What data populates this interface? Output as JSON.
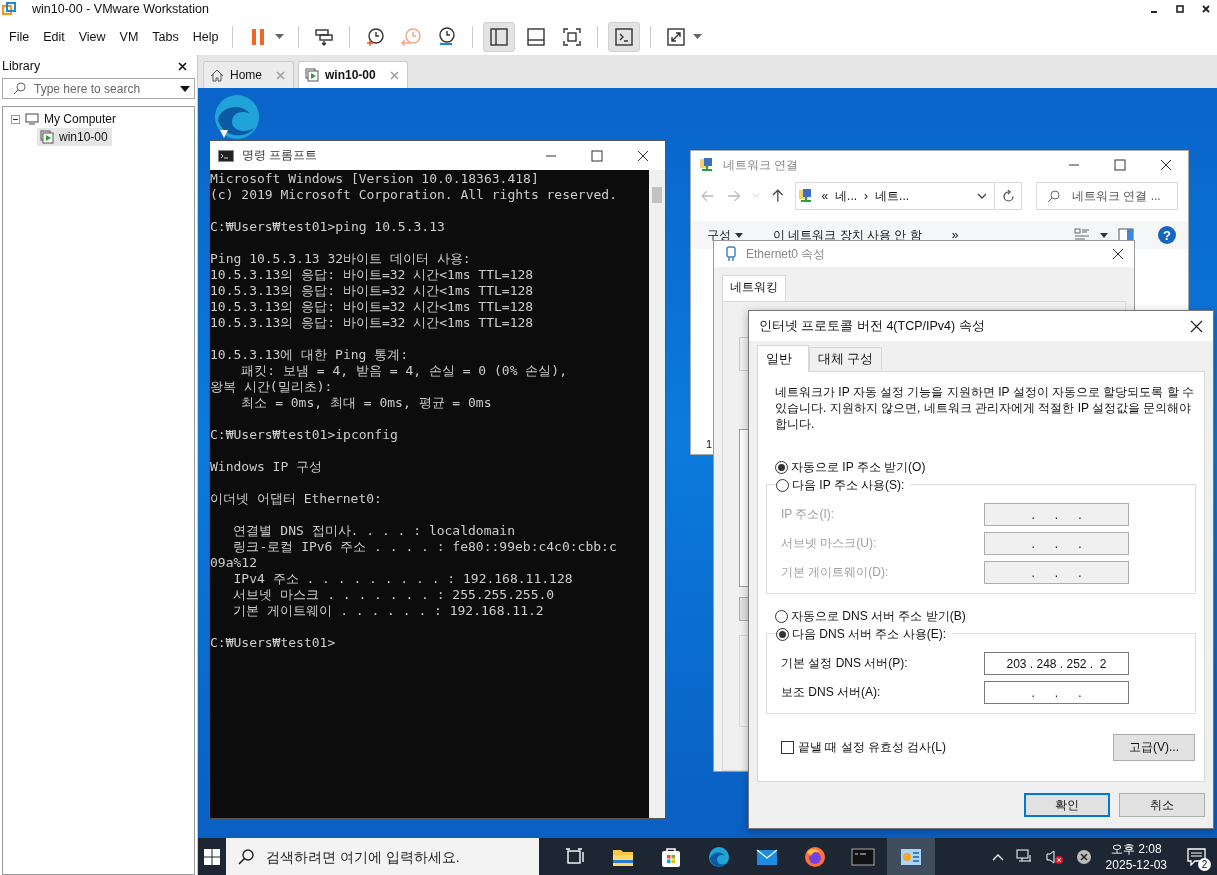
{
  "app": {
    "title": "win10-00 - VMware Workstation"
  },
  "menu": [
    {
      "label": "File"
    },
    {
      "label": "Edit"
    },
    {
      "label": "View"
    },
    {
      "label": "VM"
    },
    {
      "label": "Tabs"
    },
    {
      "label": "Help"
    }
  ],
  "toolbar": [
    [
      {
        "kind": "pause",
        "dropdown": true,
        "selected": false
      }
    ],
    [
      {
        "kind": "send-keys",
        "dropdown": false,
        "selected": false
      }
    ],
    [
      {
        "kind": "snapshot-take",
        "dropdown": false,
        "selected": false
      },
      {
        "kind": "snapshot-revert",
        "dropdown": false,
        "selected": false
      },
      {
        "kind": "snapshot-manager",
        "dropdown": false,
        "selected": false
      }
    ],
    [
      {
        "kind": "view-library",
        "dropdown": false,
        "selected": true
      },
      {
        "kind": "view-thumbnails",
        "dropdown": false,
        "selected": false
      },
      {
        "kind": "view-full",
        "dropdown": false,
        "selected": false
      }
    ],
    [
      {
        "kind": "console",
        "dropdown": false,
        "selected": true
      }
    ],
    [
      {
        "kind": "stretch",
        "dropdown": true,
        "selected": false
      }
    ]
  ],
  "library": {
    "title": "Library",
    "search": {
      "placeholder": "Type here to search"
    },
    "tree": [
      {
        "label": "My Computer",
        "expanded": true,
        "selected": false,
        "children": [
          {
            "label": "win10-00",
            "selected": true
          }
        ]
      }
    ]
  },
  "tabs": [
    {
      "label": "Home",
      "kind": "home",
      "selected": false
    },
    {
      "label": "win10-00",
      "kind": "vm",
      "selected": true
    }
  ],
  "desktop_icons": [
    {
      "kind": "edge"
    }
  ],
  "cmd": {
    "title": "명령 프롬프트",
    "blocks": [
      {
        "lines": [
          "Microsoft Windows [Version 10.0.18363.418]",
          "(c) 2019 Microsoft Corporation. All rights reserved."
        ]
      },
      {
        "lines": [
          "C:₩Users₩test01>ping 10.5.3.13"
        ]
      },
      {
        "lines": [
          "Ping 10.5.3.13 32바이트 데이터 사용:",
          "10.5.3.13의 응답: 바이트=32 시간<1ms TTL=128",
          "10.5.3.13의 응답: 바이트=32 시간<1ms TTL=128",
          "10.5.3.13의 응답: 바이트=32 시간<1ms TTL=128",
          "10.5.3.13의 응답: 바이트=32 시간<1ms TTL=128"
        ]
      },
      {
        "lines": [
          "10.5.3.13에 대한 Ping 통계:",
          "    패킷: 보냄 = 4, 받음 = 4, 손실 = 0 (0% 손실),",
          "왕복 시간(밀리초):",
          "    최소 = 0ms, 최대 = 0ms, 평균 = 0ms"
        ]
      },
      {
        "lines": [
          "C:₩Users₩test01>ipconfig"
        ]
      },
      {
        "lines": [
          "Windows IP 구성"
        ]
      },
      {
        "lines": [
          "이더넷 어댑터 Ethernet0:"
        ]
      },
      {
        "lines": [
          "   연결별 DNS 접미사. . . . : localdomain",
          "   링크-로컬 IPv6 주소 . . . . : fe80::99eb:c4c0:cbb:c",
          "09a%12",
          "   IPv4 주소 . . . . . . . . . : 192.168.11.128",
          "   서브넷 마스크 . . . . . . . : 255.255.255.0",
          "   기본 게이트웨이 . . . . . . : 192.168.11.2"
        ]
      },
      {
        "lines": [
          "C:₩Users₩test01>"
        ]
      }
    ]
  },
  "network_connections": {
    "title": "네트워크 연결",
    "breadcrumb": [
      "«",
      "네...",
      "›",
      "네트..."
    ],
    "search": {
      "placeholder": "네트워크 연결 ..."
    },
    "commands": [
      {
        "label": "구성",
        "dropdown": true
      },
      {
        "label": "이 네트워크 장치 사용 안 함",
        "dropdown": false
      },
      {
        "label": "»",
        "dropdown": false
      }
    ],
    "help": "?",
    "status": "1"
  },
  "ethernet_properties": {
    "title": "Ethernet0 속성",
    "tabs": [
      {
        "label": "네트워킹",
        "selected": true
      }
    ]
  },
  "ipv4_properties": {
    "title": "인터넷 프로토콜 버전 4(TCP/IPv4) 속성",
    "tabs": [
      {
        "label": "일반",
        "selected": true
      },
      {
        "label": "대체 구성",
        "selected": false
      }
    ],
    "description": "네트워크가 IP 자동 설정 기능을 지원하면 IP 설정이 자동으로 할당되도록 할 수 있습니다. 지원하지 않으면, 네트워크 관리자에게 적절한 IP 설정값을 문의해야 합니다.",
    "ip_options": [
      {
        "label": "자동으로 IP 주소 받기(O)",
        "selected": true
      },
      {
        "label": "다음 IP 주소 사용(S):",
        "selected": false
      }
    ],
    "ip_fields": [
      {
        "label": "IP 주소(I):",
        "value": ".      .      .",
        "disabled": true
      },
      {
        "label": "서브넷 마스크(U):",
        "value": ".      .      .",
        "disabled": true
      },
      {
        "label": "기본 게이트웨이(D):",
        "value": ".      .      .",
        "disabled": true
      }
    ],
    "dns_options": [
      {
        "label": "자동으로 DNS 서버 주소 받기(B)",
        "selected": false
      },
      {
        "label": "다음 DNS 서버 주소 사용(E):",
        "selected": true
      }
    ],
    "dns_fields": [
      {
        "label": "기본 설정 DNS 서버(P):",
        "value": "203 . 248 . 252 .  2",
        "disabled": false
      },
      {
        "label": "보조 DNS 서버(A):",
        "value": ".      .      .",
        "disabled": false
      }
    ],
    "validate": {
      "label": "끝낼 때 설정 유효성 검사(L)",
      "checked": false
    },
    "advanced": "고급(V)...",
    "buttons": [
      {
        "label": "확인",
        "default": true
      },
      {
        "label": "취소",
        "default": false
      }
    ]
  },
  "taskbar": {
    "search": {
      "placeholder": "검색하려면 여기에 입력하세요."
    },
    "apps": [
      {
        "kind": "task-view",
        "active": false
      },
      {
        "kind": "folder",
        "active": false
      },
      {
        "kind": "store",
        "active": false
      },
      {
        "kind": "edge",
        "active": false
      },
      {
        "kind": "mail",
        "active": false
      },
      {
        "kind": "firefox",
        "active": false
      },
      {
        "kind": "terminal",
        "active": false
      },
      {
        "kind": "control-panel",
        "active": true
      }
    ],
    "time": "오후 2:08",
    "date": "2025-12-03",
    "notifications": "2"
  }
}
